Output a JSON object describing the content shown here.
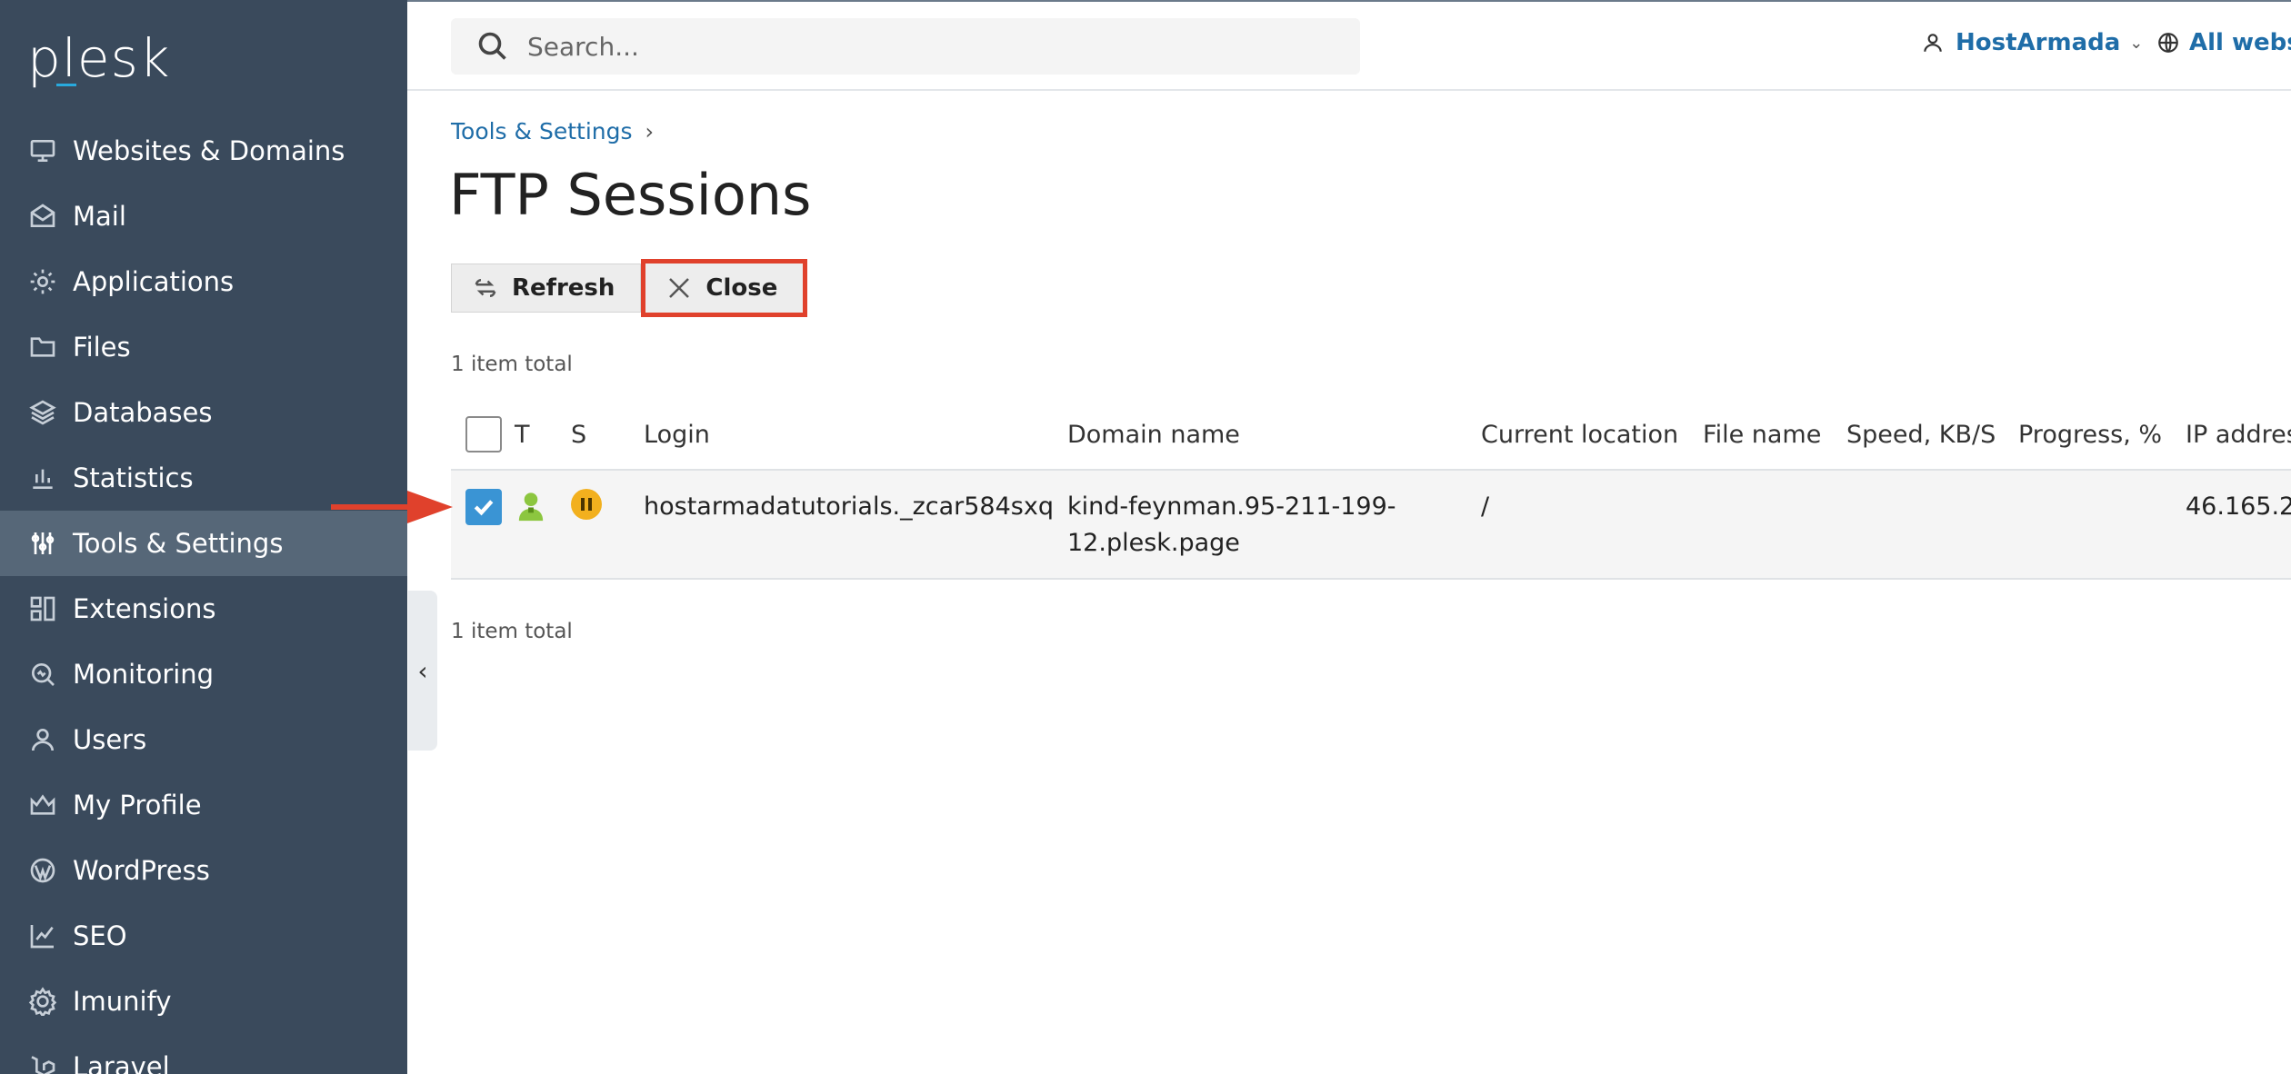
{
  "sidebar": {
    "logo": "plesk",
    "items": [
      {
        "label": "Websites & Domains",
        "icon": "monitor-icon"
      },
      {
        "label": "Mail",
        "icon": "mail-icon"
      },
      {
        "label": "Applications",
        "icon": "gear-icon"
      },
      {
        "label": "Files",
        "icon": "folder-icon"
      },
      {
        "label": "Databases",
        "icon": "database-icon"
      },
      {
        "label": "Statistics",
        "icon": "bar-chart-icon"
      },
      {
        "label": "Tools & Settings",
        "icon": "sliders-icon",
        "active": true
      },
      {
        "label": "Extensions",
        "icon": "extensions-icon"
      },
      {
        "label": "Monitoring",
        "icon": "monitoring-icon"
      },
      {
        "label": "Users",
        "icon": "user-icon"
      },
      {
        "label": "My Profile",
        "icon": "crown-icon"
      },
      {
        "label": "WordPress",
        "icon": "wordpress-icon"
      },
      {
        "label": "SEO",
        "icon": "seo-icon"
      },
      {
        "label": "Imunify",
        "icon": "shield-gear-icon"
      },
      {
        "label": "Laravel",
        "icon": "laravel-icon"
      }
    ],
    "collapse_glyph": "‹"
  },
  "header": {
    "search_placeholder": "Search...",
    "user_label": "HostArmada",
    "user_chevron": "⌄",
    "websp_label": "All websp"
  },
  "breadcrumb": {
    "item": "Tools & Settings",
    "sep": "›"
  },
  "page": {
    "title": "FTP Sessions",
    "refresh_label": "Refresh",
    "close_label": "Close",
    "total_top": "1 item total",
    "total_bottom": "1 item total"
  },
  "table": {
    "headers": {
      "t": "T",
      "s": "S",
      "login": "Login",
      "domain": "Domain name",
      "location": "Current location",
      "file": "File name",
      "speed": "Speed, KB/S",
      "progress": "Progress, %",
      "ip": "IP addres"
    },
    "rows": [
      {
        "checked": true,
        "login": "hostarmadatutorials._zcar584sxq",
        "domain_line1": "kind-feynman.95-211-199-",
        "domain_line2": "12.plesk.page",
        "location": "/",
        "file": "",
        "speed": "",
        "progress": "",
        "ip": "46.165.2"
      }
    ]
  },
  "colors": {
    "sidebar_bg": "#3a4a5c",
    "sidebar_active": "#566778",
    "link": "#1f6da8",
    "highlight_box": "#e0412c",
    "checkbox_checked": "#3a94d4",
    "status_paused": "#f2b01e"
  }
}
